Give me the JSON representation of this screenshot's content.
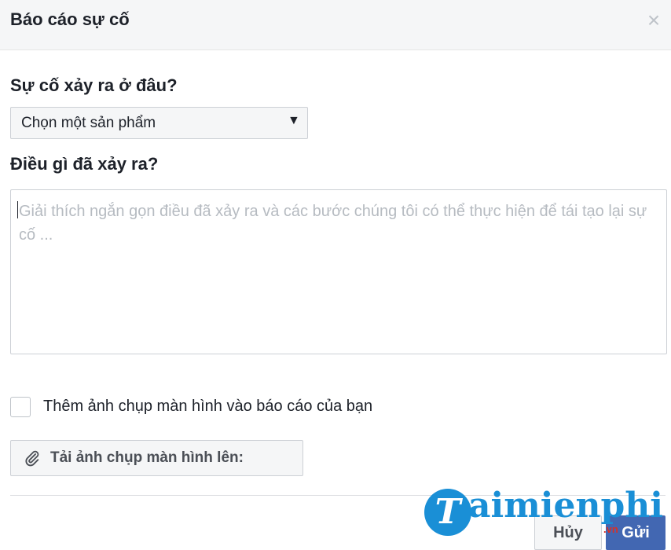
{
  "dialog": {
    "title": "Báo cáo sự cố",
    "close_icon": "close-icon",
    "close_glyph": "×"
  },
  "location": {
    "question": "Sự cố xảy ra ở đâu?",
    "select_value": "Chọn một sản phẩm",
    "select_arrow": "▼"
  },
  "description": {
    "question": "Điều gì đã xảy ra?",
    "placeholder": "Giải thích ngắn gọn điều đã xảy ra và các bước chúng tôi có thể thực hiện để tái tạo lại sự cố ..."
  },
  "screenshot": {
    "checkbox_label": "Thêm ảnh chụp màn hình vào báo cáo của bạn",
    "checked": false,
    "upload_label": "Tải ảnh chụp màn hình lên:",
    "upload_icon": "paperclip-icon"
  },
  "footer": {
    "cancel_label": "Hủy",
    "send_label": "Gửi"
  },
  "watermark": {
    "logo_letter": "T",
    "text": "aimienphi",
    "sub": ".vn"
  },
  "colors": {
    "primary": "#4267b2",
    "watermark": "#1a8fd6",
    "header_bg": "#f5f6f7",
    "border": "#ccd0d5"
  }
}
